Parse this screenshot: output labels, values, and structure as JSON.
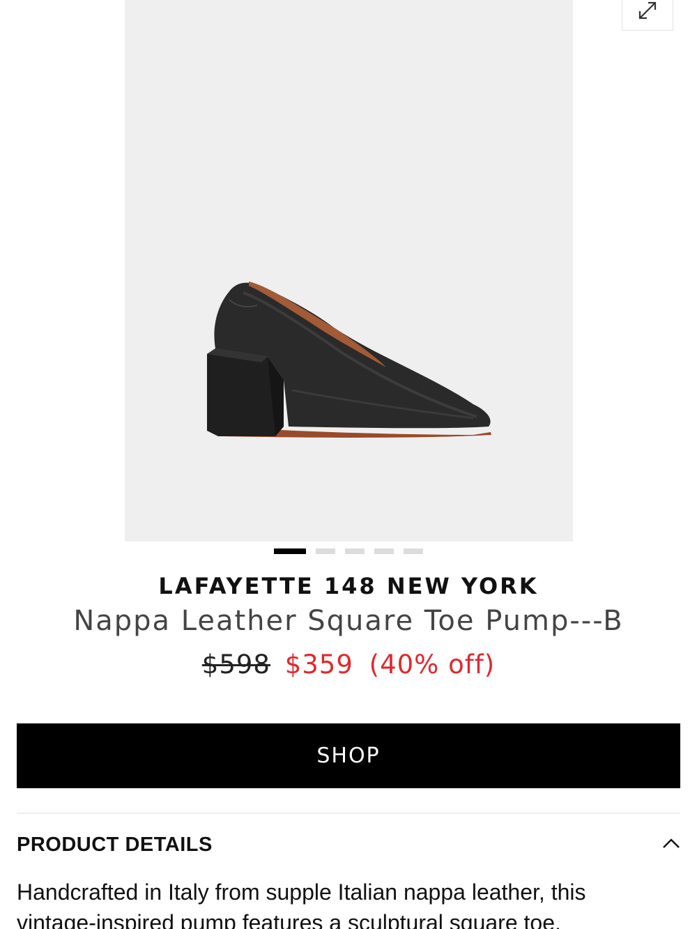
{
  "gallery": {
    "image_alt": "Black nappa leather square toe pump with block heel",
    "expand_icon": "expand-diagonal-arrows-icon",
    "dots": [
      {
        "active": true
      },
      {
        "active": false
      },
      {
        "active": false
      },
      {
        "active": false
      },
      {
        "active": false
      }
    ]
  },
  "product": {
    "brand": "LAFAYETTE 148 NEW YORK",
    "name": "Nappa Leather Square Toe Pump---B",
    "price_original": "$598",
    "price_sale": "$359",
    "discount": "(40% off)"
  },
  "actions": {
    "shop_label": "SHOP"
  },
  "details": {
    "title": "PRODUCT DETAILS",
    "toggle_icon": "chevron-up-icon",
    "description": "Handcrafted in Italy from supple Italian nappa leather, this vintage-inspired pump features a sculptural square toe, matched by the"
  },
  "colors": {
    "accent_sale": "#e0282e",
    "button_bg": "#000000",
    "image_bg": "#efefef"
  }
}
